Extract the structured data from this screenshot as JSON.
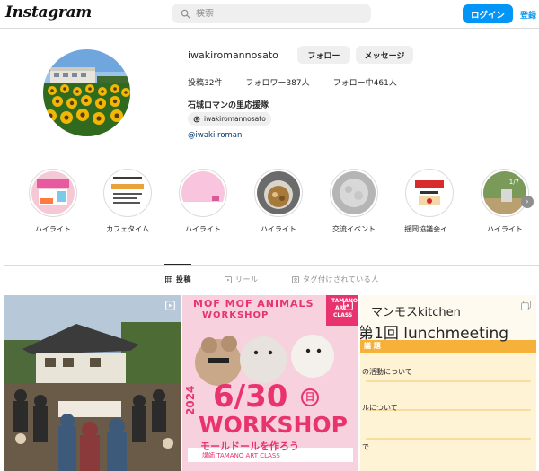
{
  "header": {
    "logo_text": "Instagram",
    "search_placeholder": "検索",
    "login_label": "ログイン",
    "signup_label": "登録"
  },
  "profile": {
    "username": "iwakiromannosato",
    "follow_label": "フォロー",
    "message_label": "メッセージ",
    "stats": {
      "posts": "投稿32件",
      "followers": "フォロワー387人",
      "following": "フォロー中461人"
    },
    "full_name": "石城ロマンの里応援隊",
    "threads_handle": "iwakiromannosato",
    "link_text": "@iwaki.roman"
  },
  "highlights": [
    {
      "label": "ハイライト",
      "cover_text": "4月29日"
    },
    {
      "label": "カフェタイム",
      "cover_text": "Cafetime"
    },
    {
      "label": "ハイライト",
      "cover_text": ""
    },
    {
      "label": "ハイライト",
      "cover_text": ""
    },
    {
      "label": "交流イベント",
      "cover_text": ""
    },
    {
      "label": "揺岡協議会イ...",
      "cover_text": "益獅り大会"
    },
    {
      "label": "ハイライト",
      "cover_text": "1/7"
    }
  ],
  "tabs": [
    {
      "label": "投稿",
      "active": true
    },
    {
      "label": "リール",
      "active": false
    },
    {
      "label": "タグ付けされている人",
      "active": false
    }
  ],
  "posts": [
    {
      "kind": "photo",
      "overlay_text": []
    },
    {
      "kind": "reel",
      "overlay_text": [
        "MOF MOF ANIMALS",
        "WORKSHOP",
        "2024",
        "6/30",
        "日",
        "WORKSHOP",
        "モールドールを作ろう",
        "講師 TAMANO ART CLASS",
        "TAMANO",
        "ART",
        "CLASS"
      ]
    },
    {
      "kind": "carousel",
      "overlay_text": [
        "マンモスkitchen",
        "第1回 lunchmeeting",
        "議 題",
        "の活動について",
        "ルについて",
        "で"
      ]
    }
  ],
  "colors": {
    "accent": "#0095f6",
    "link": "#00376b",
    "button_bg": "#efefef",
    "border": "#dbdbdb",
    "workshop_pink": "#e8336f"
  }
}
